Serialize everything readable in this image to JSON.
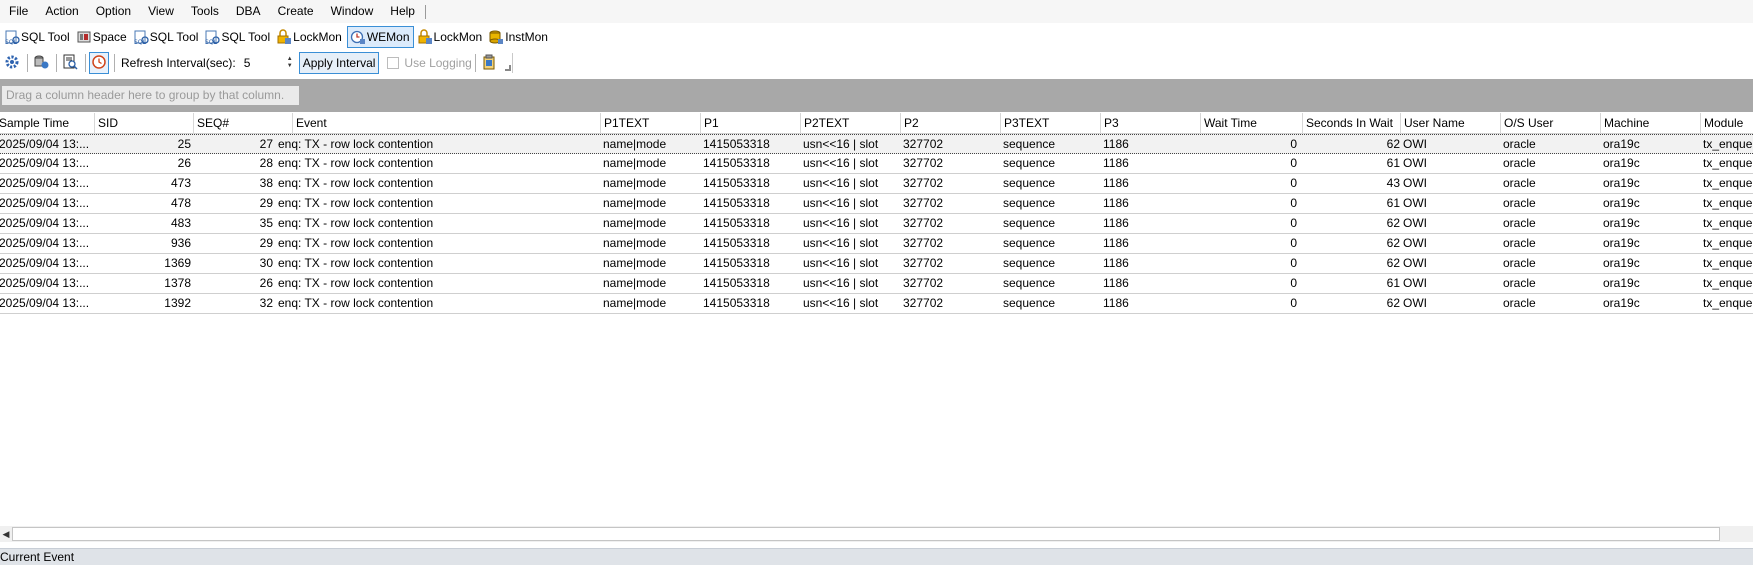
{
  "menu": [
    "File",
    "Action",
    "Option",
    "View",
    "Tools",
    "DBA",
    "Create",
    "Window",
    "Help"
  ],
  "modules": [
    {
      "label": "SQL Tool",
      "icon": "sql-tool-icon",
      "active": false
    },
    {
      "label": "Space",
      "icon": "space-icon",
      "active": false
    },
    {
      "label": "SQL Tool",
      "icon": "sql-tool-icon",
      "active": false
    },
    {
      "label": "SQL Tool",
      "icon": "sql-tool-icon",
      "active": false
    },
    {
      "label": "LockMon",
      "icon": "lock-monitor-icon",
      "active": false
    },
    {
      "label": "WEMon",
      "icon": "wait-event-monitor-icon",
      "active": true
    },
    {
      "label": "LockMon",
      "icon": "lock-monitor-icon",
      "active": false
    },
    {
      "label": "InstMon",
      "icon": "instance-monitor-icon",
      "active": false
    }
  ],
  "toolbar": {
    "refresh_label": "Refresh Interval(sec):",
    "refresh_value": "5",
    "apply_label": "Apply Interval",
    "logging_label": "Use Logging"
  },
  "group_panel_hint": "Drag a column header here to group by that column.",
  "grid": {
    "columns": [
      "Sample Time",
      "SID",
      "SEQ#",
      "Event",
      "P1TEXT",
      "P1",
      "P2TEXT",
      "P2",
      "P3TEXT",
      "P3",
      "Wait Time",
      "Seconds In Wait",
      "User Name",
      "O/S User",
      "Machine",
      "Module"
    ],
    "rows": [
      [
        "2025/09/04 13:...",
        "25",
        "27",
        "enq: TX - row lock contention",
        "name|mode",
        "1415053318",
        "usn<<16 | slot",
        "327702",
        "sequence",
        "1186",
        "0",
        "62",
        "OWI",
        "oracle",
        "ora19c",
        "tx_enqueue"
      ],
      [
        "2025/09/04 13:...",
        "26",
        "28",
        "enq: TX - row lock contention",
        "name|mode",
        "1415053318",
        "usn<<16 | slot",
        "327702",
        "sequence",
        "1186",
        "0",
        "61",
        "OWI",
        "oracle",
        "ora19c",
        "tx_enqueue"
      ],
      [
        "2025/09/04 13:...",
        "473",
        "38",
        "enq: TX - row lock contention",
        "name|mode",
        "1415053318",
        "usn<<16 | slot",
        "327702",
        "sequence",
        "1186",
        "0",
        "43",
        "OWI",
        "oracle",
        "ora19c",
        "tx_enqueue"
      ],
      [
        "2025/09/04 13:...",
        "478",
        "29",
        "enq: TX - row lock contention",
        "name|mode",
        "1415053318",
        "usn<<16 | slot",
        "327702",
        "sequence",
        "1186",
        "0",
        "61",
        "OWI",
        "oracle",
        "ora19c",
        "tx_enqueue"
      ],
      [
        "2025/09/04 13:...",
        "483",
        "35",
        "enq: TX - row lock contention",
        "name|mode",
        "1415053318",
        "usn<<16 | slot",
        "327702",
        "sequence",
        "1186",
        "0",
        "62",
        "OWI",
        "oracle",
        "ora19c",
        "tx_enqueue"
      ],
      [
        "2025/09/04 13:...",
        "936",
        "29",
        "enq: TX - row lock contention",
        "name|mode",
        "1415053318",
        "usn<<16 | slot",
        "327702",
        "sequence",
        "1186",
        "0",
        "62",
        "OWI",
        "oracle",
        "ora19c",
        "tx_enqueue"
      ],
      [
        "2025/09/04 13:...",
        "1369",
        "30",
        "enq: TX - row lock contention",
        "name|mode",
        "1415053318",
        "usn<<16 | slot",
        "327702",
        "sequence",
        "1186",
        "0",
        "62",
        "OWI",
        "oracle",
        "ora19c",
        "tx_enqueue"
      ],
      [
        "2025/09/04 13:...",
        "1378",
        "26",
        "enq: TX - row lock contention",
        "name|mode",
        "1415053318",
        "usn<<16 | slot",
        "327702",
        "sequence",
        "1186",
        "0",
        "61",
        "OWI",
        "oracle",
        "ora19c",
        "tx_enqueue"
      ],
      [
        "2025/09/04 13:...",
        "1392",
        "32",
        "enq: TX - row lock contention",
        "name|mode",
        "1415053318",
        "usn<<16 | slot",
        "327702",
        "sequence",
        "1186",
        "0",
        "62",
        "OWI",
        "oracle",
        "ora19c",
        "tx_enqueue"
      ]
    ]
  },
  "status_text": "Current Event"
}
